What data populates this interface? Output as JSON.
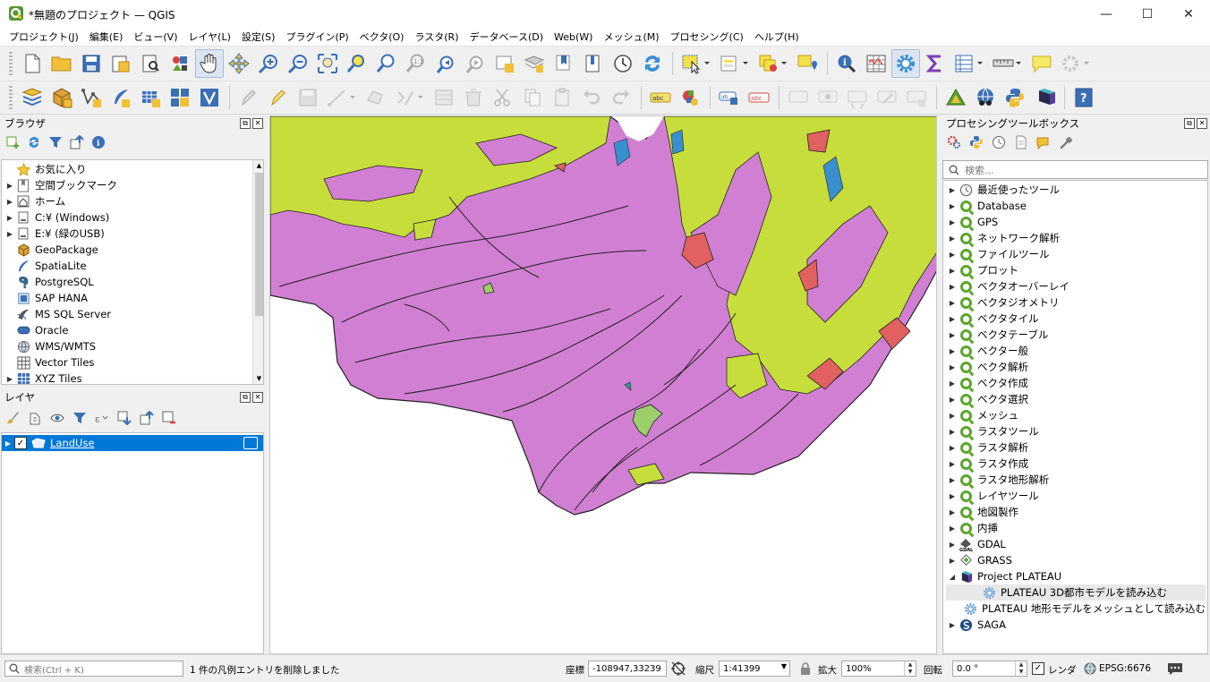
{
  "window": {
    "title": "*無題のプロジェクト — QGIS",
    "minimize_glyph": "—",
    "maximize_glyph": "☐",
    "close_glyph": "✕"
  },
  "menu": [
    "プロジェクト(J)",
    "編集(E)",
    "ビュー(V)",
    "レイヤ(L)",
    "設定(S)",
    "プラグイン(P)",
    "ベクタ(O)",
    "ラスタ(R)",
    "データベース(D)",
    "Web(W)",
    "メッシュ(M)",
    "プロセシング(C)",
    "ヘルプ(H)"
  ],
  "browser": {
    "title": "ブラウザ",
    "items": [
      {
        "label": "お気に入り",
        "icon": "star-icon"
      },
      {
        "label": "空間ブックマーク",
        "icon": "bookmark-icon"
      },
      {
        "label": "ホーム",
        "icon": "home-icon"
      },
      {
        "label": "C:¥ (Windows)",
        "icon": "drive-icon"
      },
      {
        "label": "E:¥ (緑のUSB)",
        "icon": "drive-icon"
      },
      {
        "label": "GeoPackage",
        "icon": "geopackage-icon"
      },
      {
        "label": "SpatiaLite",
        "icon": "spatialite-icon"
      },
      {
        "label": "PostgreSQL",
        "icon": "postgresql-icon"
      },
      {
        "label": "SAP HANA",
        "icon": "sap-hana-icon"
      },
      {
        "label": "MS SQL Server",
        "icon": "mssql-icon"
      },
      {
        "label": "Oracle",
        "icon": "oracle-icon"
      },
      {
        "label": "WMS/WMTS",
        "icon": "wms-icon"
      },
      {
        "label": "Vector Tiles",
        "icon": "vector-tiles-icon"
      },
      {
        "label": "XYZ Tiles",
        "icon": "xyz-tiles-icon"
      }
    ]
  },
  "layers": {
    "title": "レイヤ",
    "items": [
      {
        "label": "LandUse",
        "checked": true
      }
    ]
  },
  "processing": {
    "title": "プロセシングツールボックス",
    "search_placeholder": "検索...",
    "items": [
      {
        "label": "最近使ったツール",
        "icon": "clock-icon"
      },
      {
        "label": "Database",
        "icon": "qgis-icon"
      },
      {
        "label": "GPS",
        "icon": "qgis-icon"
      },
      {
        "label": "ネットワーク解析",
        "icon": "qgis-icon"
      },
      {
        "label": "ファイルツール",
        "icon": "qgis-icon"
      },
      {
        "label": "プロット",
        "icon": "qgis-icon"
      },
      {
        "label": "ベクタオーバーレイ",
        "icon": "qgis-icon"
      },
      {
        "label": "ベクタジオメトリ",
        "icon": "qgis-icon"
      },
      {
        "label": "ベクタタイル",
        "icon": "qgis-icon"
      },
      {
        "label": "ベクタテーブル",
        "icon": "qgis-icon"
      },
      {
        "label": "ベクター般",
        "icon": "qgis-icon"
      },
      {
        "label": "ベクタ解析",
        "icon": "qgis-icon"
      },
      {
        "label": "ベクタ作成",
        "icon": "qgis-icon"
      },
      {
        "label": "ベクタ選択",
        "icon": "qgis-icon"
      },
      {
        "label": "メッシュ",
        "icon": "qgis-icon"
      },
      {
        "label": "ラスタツール",
        "icon": "qgis-icon"
      },
      {
        "label": "ラスタ解析",
        "icon": "qgis-icon"
      },
      {
        "label": "ラスタ作成",
        "icon": "qgis-icon"
      },
      {
        "label": "ラスタ地形解析",
        "icon": "qgis-icon"
      },
      {
        "label": "レイヤツール",
        "icon": "qgis-icon"
      },
      {
        "label": "地図製作",
        "icon": "qgis-icon"
      },
      {
        "label": "内挿",
        "icon": "qgis-icon"
      },
      {
        "label": "GDAL",
        "icon": "gdal-icon"
      },
      {
        "label": "GRASS",
        "icon": "grass-icon"
      },
      {
        "label": "Project PLATEAU",
        "icon": "plateau-icon",
        "expanded": true
      },
      {
        "label": "PLATEAU 3D都市モデルを読み込む",
        "icon": "gear-icon",
        "child": true,
        "hover": true
      },
      {
        "label": "PLATEAU 地形モデルをメッシュとして読み込む",
        "icon": "gear-icon",
        "child": true
      },
      {
        "label": "SAGA",
        "icon": "saga-icon"
      }
    ]
  },
  "status": {
    "search_placeholder": "検索(Ctrl + K)",
    "message": "1 件の凡例エントリを削除しました",
    "coord_label": "座標",
    "coord_value": "-108947,33239",
    "scale_label": "縮尺",
    "scale_value": "1:41399",
    "magnifier_label": "拡大",
    "magnifier_value": "100%",
    "rotation_label": "回転",
    "rotation_value": "0.0 °",
    "render_label": "レンダ",
    "render_checked": true,
    "crs": "EPSG:6676"
  },
  "colors": {
    "map_pink": "#d17fd2",
    "map_lime": "#c6dd3b",
    "map_red": "#e0615f",
    "map_green": "#9ccf6a",
    "selection": "#0078d7",
    "qgis_green": "#5ca52e"
  }
}
